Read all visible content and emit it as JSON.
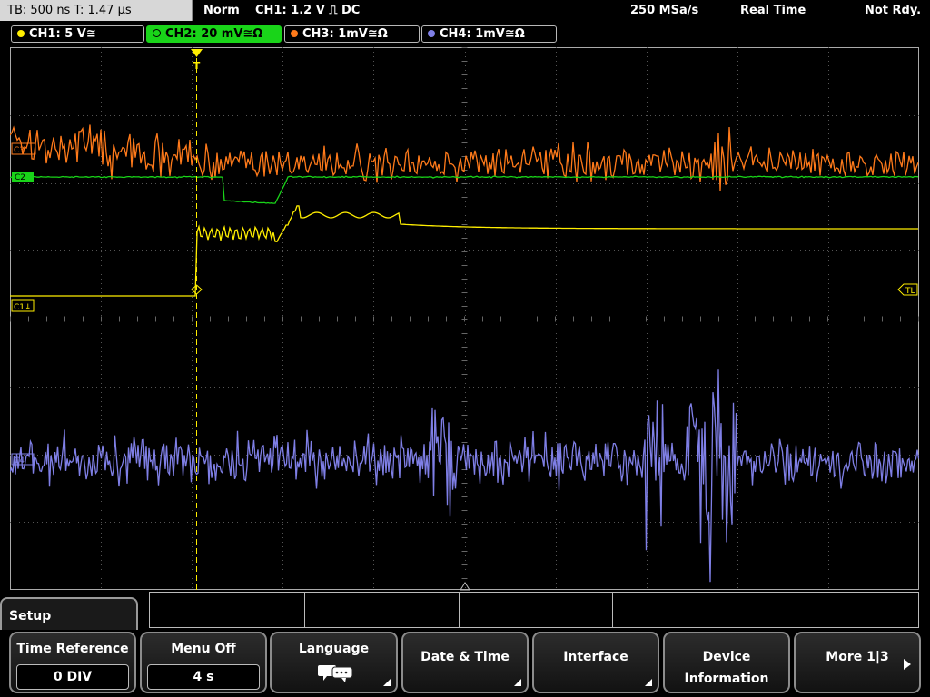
{
  "header": {
    "timebase": "TB: 500 ns   T: 1.47 µs",
    "mode": "Norm",
    "trigger": "CH1: 1.2 V ⎍ DC",
    "sample_rate": "250 MSa/s",
    "acq_mode": "Real Time",
    "status": "Not Rdy."
  },
  "channels": [
    {
      "label": "CH1: 5 V≅",
      "color": "#ffee00"
    },
    {
      "label": "CH2: 20 mV≅Ω",
      "color": "#19d419"
    },
    {
      "label": "CH3: 1mV≅Ω",
      "color": "#ff7a1a"
    },
    {
      "label": "CH4: 1mV≅Ω",
      "color": "#7f7fe6"
    }
  ],
  "markers": {
    "trigger_pos": "T",
    "ch1_marker": "C1↓",
    "ch2_marker": "C2",
    "ch3_marker": "C3",
    "ch4_marker": "C4",
    "trigger_level": "TL"
  },
  "menu": {
    "title": "Setup",
    "softkeys": [
      {
        "label": "Time Reference",
        "value": "0 DIV"
      },
      {
        "label": "Menu Off",
        "value": "4 s"
      },
      {
        "label": "Language",
        "icon": "speech-bubble-icon"
      },
      {
        "label": "Date & Time"
      },
      {
        "label": "Interface"
      },
      {
        "label_line1": "Device",
        "label_line2": "Information"
      },
      {
        "label": "More 1|3"
      }
    ]
  }
}
